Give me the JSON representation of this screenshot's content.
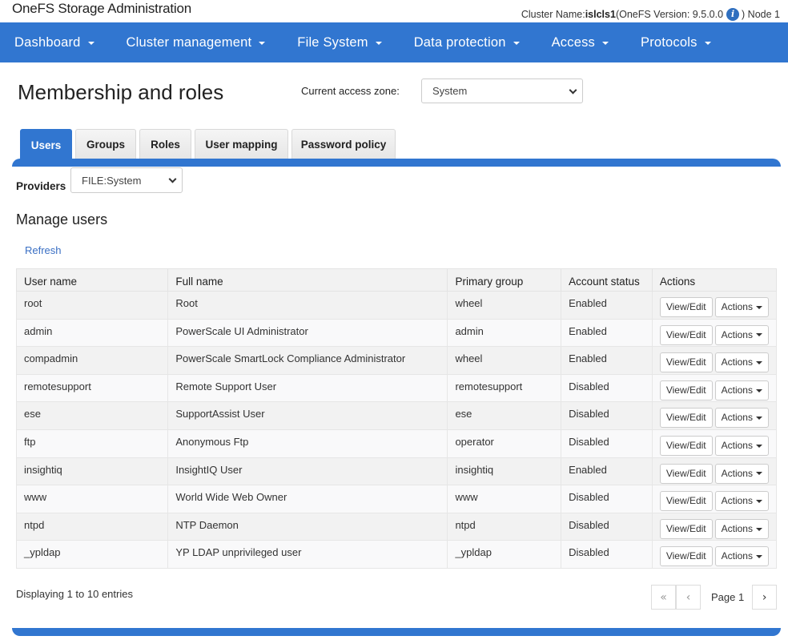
{
  "header": {
    "app_title": "OneFS Storage Administration",
    "cluster_label": "Cluster Name: ",
    "cluster_name": "islcls1",
    "version_text": "(OneFS Version: 9.5.0.0",
    "info_icon": "info-icon",
    "node_text": ") Node 1"
  },
  "nav": {
    "items": [
      {
        "label": "Dashboard"
      },
      {
        "label": "Cluster management"
      },
      {
        "label": "File System"
      },
      {
        "label": "Data protection"
      },
      {
        "label": "Access"
      },
      {
        "label": "Protocols"
      }
    ]
  },
  "page": {
    "title": "Membership and roles",
    "zone_label": "Current access zone:",
    "zone_value": "System"
  },
  "tabs": [
    {
      "label": "Users",
      "active": true
    },
    {
      "label": "Groups"
    },
    {
      "label": "Roles"
    },
    {
      "label": "User mapping"
    },
    {
      "label": "Password policy"
    }
  ],
  "providers": {
    "label": "Providers",
    "value": "FILE:System"
  },
  "section": {
    "title": "Manage users",
    "refresh_label": "Refresh"
  },
  "table": {
    "columns": [
      "User name",
      "Full name",
      "Primary group",
      "Account status",
      "Actions"
    ],
    "view_edit_label": "View/Edit",
    "actions_label": "Actions",
    "rows": [
      {
        "user": "root",
        "full": "Root",
        "group": "wheel",
        "status": "Enabled"
      },
      {
        "user": "admin",
        "full": "PowerScale UI Administrator",
        "group": "admin",
        "status": "Enabled"
      },
      {
        "user": "compadmin",
        "full": "PowerScale SmartLock Compliance Administrator",
        "group": "wheel",
        "status": "Enabled"
      },
      {
        "user": "remotesupport",
        "full": "Remote Support User",
        "group": "remotesupport",
        "status": "Disabled"
      },
      {
        "user": "ese",
        "full": "SupportAssist User",
        "group": "ese",
        "status": "Disabled"
      },
      {
        "user": "ftp",
        "full": "Anonymous Ftp",
        "group": "operator",
        "status": "Disabled"
      },
      {
        "user": "insightiq",
        "full": "InsightIQ User",
        "group": "insightiq",
        "status": "Enabled"
      },
      {
        "user": "www",
        "full": "World Wide Web Owner",
        "group": "www",
        "status": "Disabled"
      },
      {
        "user": "ntpd",
        "full": "NTP Daemon",
        "group": "ntpd",
        "status": "Disabled"
      },
      {
        "user": "_ypldap",
        "full": "YP LDAP unprivileged user",
        "group": "_ypldap",
        "status": "Disabled"
      }
    ]
  },
  "footer": {
    "display_text": "Displaying 1 to 10 entries",
    "first_glyph": "«",
    "prev_glyph": "‹",
    "page_label": "Page 1",
    "next_glyph": "›"
  },
  "colors": {
    "brand_blue": "#3176d0",
    "link_blue": "#3a6fc4"
  }
}
